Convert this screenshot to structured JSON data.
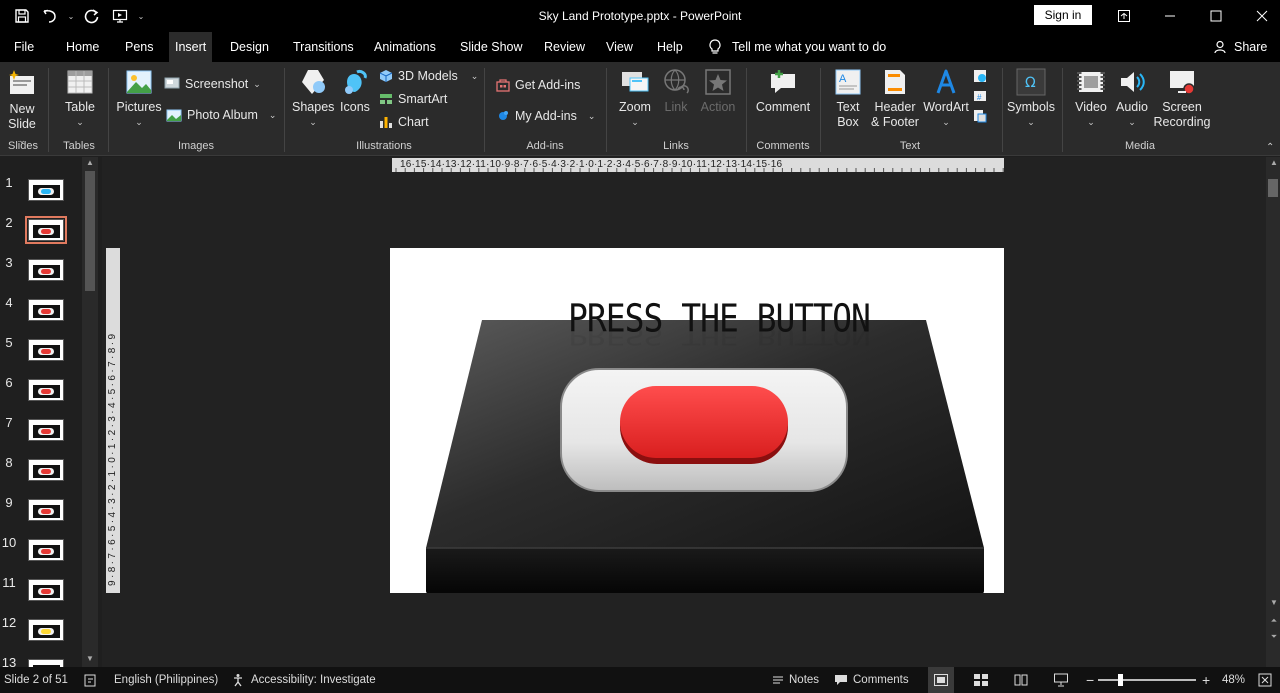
{
  "window": {
    "title": "Sky Land Prototype.pptx  -  PowerPoint",
    "sign_in": "Sign in"
  },
  "tabs": [
    {
      "label": "File"
    },
    {
      "label": "Home"
    },
    {
      "label": "Pens"
    },
    {
      "label": "Insert"
    },
    {
      "label": "Design"
    },
    {
      "label": "Transitions"
    },
    {
      "label": "Animations"
    },
    {
      "label": "Slide Show"
    },
    {
      "label": "Review"
    },
    {
      "label": "View"
    },
    {
      "label": "Help"
    }
  ],
  "active_tab": "Insert",
  "tell_me": "Tell me what you want to do",
  "share": "Share",
  "ribbon": {
    "slides": {
      "new_slide_1": "New",
      "new_slide_2": "Slide",
      "group": "Slides"
    },
    "tables": {
      "table": "Table",
      "group": "Tables"
    },
    "images": {
      "pictures": "Pictures",
      "screenshot": "Screenshot",
      "photo_album": "Photo Album",
      "group": "Images"
    },
    "illustrations": {
      "shapes": "Shapes",
      "icons": "Icons",
      "models_3d": "3D Models",
      "smartart": "SmartArt",
      "chart": "Chart",
      "group": "Illustrations"
    },
    "addins": {
      "get_addins": "Get Add-ins",
      "my_addins": "My Add-ins",
      "group": "Add-ins"
    },
    "links": {
      "zoom": "Zoom",
      "link": "Link",
      "action": "Action",
      "group": "Links"
    },
    "comments": {
      "comment": "Comment",
      "group": "Comments"
    },
    "text": {
      "text_box_1": "Text",
      "text_box_2": "Box",
      "header_footer_1": "Header",
      "header_footer_2": "& Footer",
      "wordart": "WordArt",
      "group": "Text"
    },
    "symbols": {
      "symbols": "Symbols"
    },
    "media": {
      "video": "Video",
      "audio": "Audio",
      "screen_rec_1": "Screen",
      "screen_rec_2": "Recording",
      "group": "Media"
    }
  },
  "slides": [
    {
      "num": "1",
      "variant": "cyan"
    },
    {
      "num": "2",
      "variant": "red"
    },
    {
      "num": "3",
      "variant": "red"
    },
    {
      "num": "4",
      "variant": "red"
    },
    {
      "num": "5",
      "variant": "red"
    },
    {
      "num": "6",
      "variant": "red"
    },
    {
      "num": "7",
      "variant": "red"
    },
    {
      "num": "8",
      "variant": "red"
    },
    {
      "num": "9",
      "variant": "red"
    },
    {
      "num": "10",
      "variant": "red"
    },
    {
      "num": "11",
      "variant": "red"
    },
    {
      "num": "12",
      "variant": "yellow"
    },
    {
      "num": "13",
      "variant": "red"
    }
  ],
  "selected_slide": "2",
  "slide_content": {
    "heading": "PRESS THE BUTTON",
    "heading_reflection": "PRESS THE BUTTON"
  },
  "ruler": {
    "horizontal": "16·15·14·13·12·11·10·9·8·7·6·5·4·3·2·1·0·1·2·3·4·5·6·7·8·9·10·11·12·13·14·15·16",
    "vertical": "9·8·7·6·5·4·3·2·1·0·1·2·3·4·5·6·7·8·9"
  },
  "status": {
    "slide_of": "Slide 2 of 51",
    "language": "English (Philippines)",
    "accessibility": "Accessibility: Investigate",
    "notes": "Notes",
    "comments": "Comments",
    "zoom": "48%",
    "zoom_minus": "−",
    "zoom_plus": "+"
  },
  "colors": {
    "button_red": "#e53935",
    "thumb_cyan": "#29b6f6",
    "thumb_yellow": "#fdd835",
    "selection": "#e07a5f"
  }
}
